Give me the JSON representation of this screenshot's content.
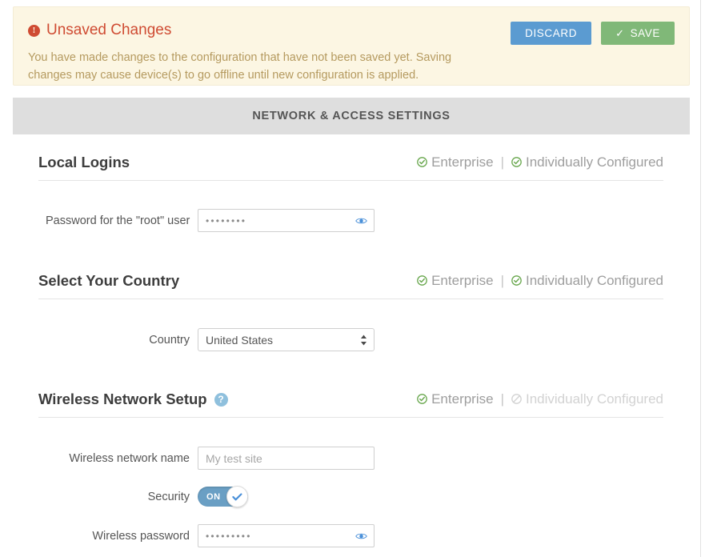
{
  "alert": {
    "icon": "alert-circle-icon",
    "title": "Unsaved Changes",
    "body": "You have made changes to the configuration that have not been saved yet. Saving changes may cause device(s) to go offline until new configuration is applied.",
    "discard_label": "DISCARD",
    "save_label": "SAVE",
    "save_icon": "check-icon",
    "discard_color": "#5b9bd1",
    "save_color": "#80b878",
    "background_color": "#fcf6e3",
    "title_color": "#cf4b32",
    "body_color": "#b59a5f"
  },
  "section_bar": {
    "title": "NETWORK & ACCESS SETTINGS",
    "background_color": "#dedede"
  },
  "scope_labels": {
    "enterprise": "Enterprise",
    "individually_configured": "Individually Configured",
    "separator": "|",
    "enabled_icon": "check-circle-icon",
    "disabled_icon": "prohibited-circle-icon",
    "enabled_color": "#6aa84f",
    "disabled_color": "#d2d2d2"
  },
  "groups": [
    {
      "title": "Local Logins",
      "help_icon": null,
      "enterprise_enabled": true,
      "individual_enabled": true,
      "rows": [
        {
          "label": "Password for the \"root\" user",
          "type": "password",
          "value": "••••••••",
          "reveal_icon": "eye-icon"
        }
      ]
    },
    {
      "title": "Select Your Country",
      "help_icon": null,
      "enterprise_enabled": true,
      "individual_enabled": true,
      "rows": [
        {
          "label": "Country",
          "type": "select",
          "value": "United States",
          "options": [
            "United States"
          ],
          "arrows_icon": "updown-arrows-icon"
        }
      ]
    },
    {
      "title": "Wireless Network Setup",
      "help_icon": "help-icon",
      "help_glyph": "?",
      "enterprise_enabled": true,
      "individual_enabled": false,
      "rows": [
        {
          "label": "Wireless network name",
          "type": "text",
          "value": "",
          "placeholder": "My test site"
        },
        {
          "label": "Security",
          "type": "toggle",
          "state": "ON",
          "toggle_label": "ON",
          "knob_icon": "check-icon",
          "on_color": "#6a9fc4"
        },
        {
          "label": "Wireless password",
          "type": "password",
          "value": "•••••••••",
          "reveal_icon": "eye-icon"
        }
      ]
    }
  ]
}
